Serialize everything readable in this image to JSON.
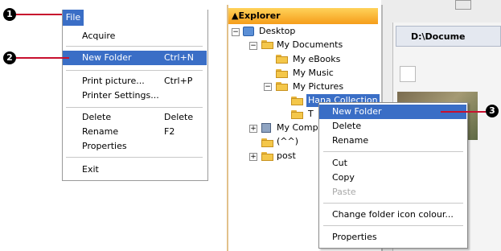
{
  "callouts": {
    "one": "1",
    "two": "2",
    "three": "3"
  },
  "file_menu": {
    "title": "File",
    "items": [
      {
        "label": "Acquire",
        "shortcut": ""
      },
      {
        "label": "New Folder",
        "shortcut": "Ctrl+N",
        "highlighted": true
      },
      {
        "label": "Print picture...",
        "shortcut": "Ctrl+P"
      },
      {
        "label": "Printer Settings...",
        "shortcut": ""
      },
      {
        "label": "Delete",
        "shortcut": "Delete"
      },
      {
        "label": "Rename",
        "shortcut": "F2"
      },
      {
        "label": "Properties",
        "shortcut": ""
      },
      {
        "label": "Exit",
        "shortcut": ""
      }
    ]
  },
  "explorer": {
    "header": "▲Explorer",
    "path": "D:\\Docume",
    "tree": [
      {
        "label": "Desktop"
      },
      {
        "label": "My Documents"
      },
      {
        "label": "My eBooks"
      },
      {
        "label": "My Music"
      },
      {
        "label": "My Pictures"
      },
      {
        "label": "Hana Collection"
      },
      {
        "label": "T"
      },
      {
        "label": "My Comp"
      },
      {
        "label": "(^^)"
      },
      {
        "label": "post"
      }
    ]
  },
  "context_menu": {
    "items": [
      {
        "label": "New Folder",
        "highlighted": true
      },
      {
        "label": "Delete"
      },
      {
        "label": "Rename"
      },
      {
        "label": "Cut"
      },
      {
        "label": "Copy"
      },
      {
        "label": "Paste",
        "disabled": true
      },
      {
        "label": "Change folder icon colour..."
      },
      {
        "label": "Properties"
      }
    ]
  },
  "colors": {
    "highlight": "#3a6ec6",
    "callout_line": "#c8102e",
    "explorer_header": "#f59d1a"
  }
}
